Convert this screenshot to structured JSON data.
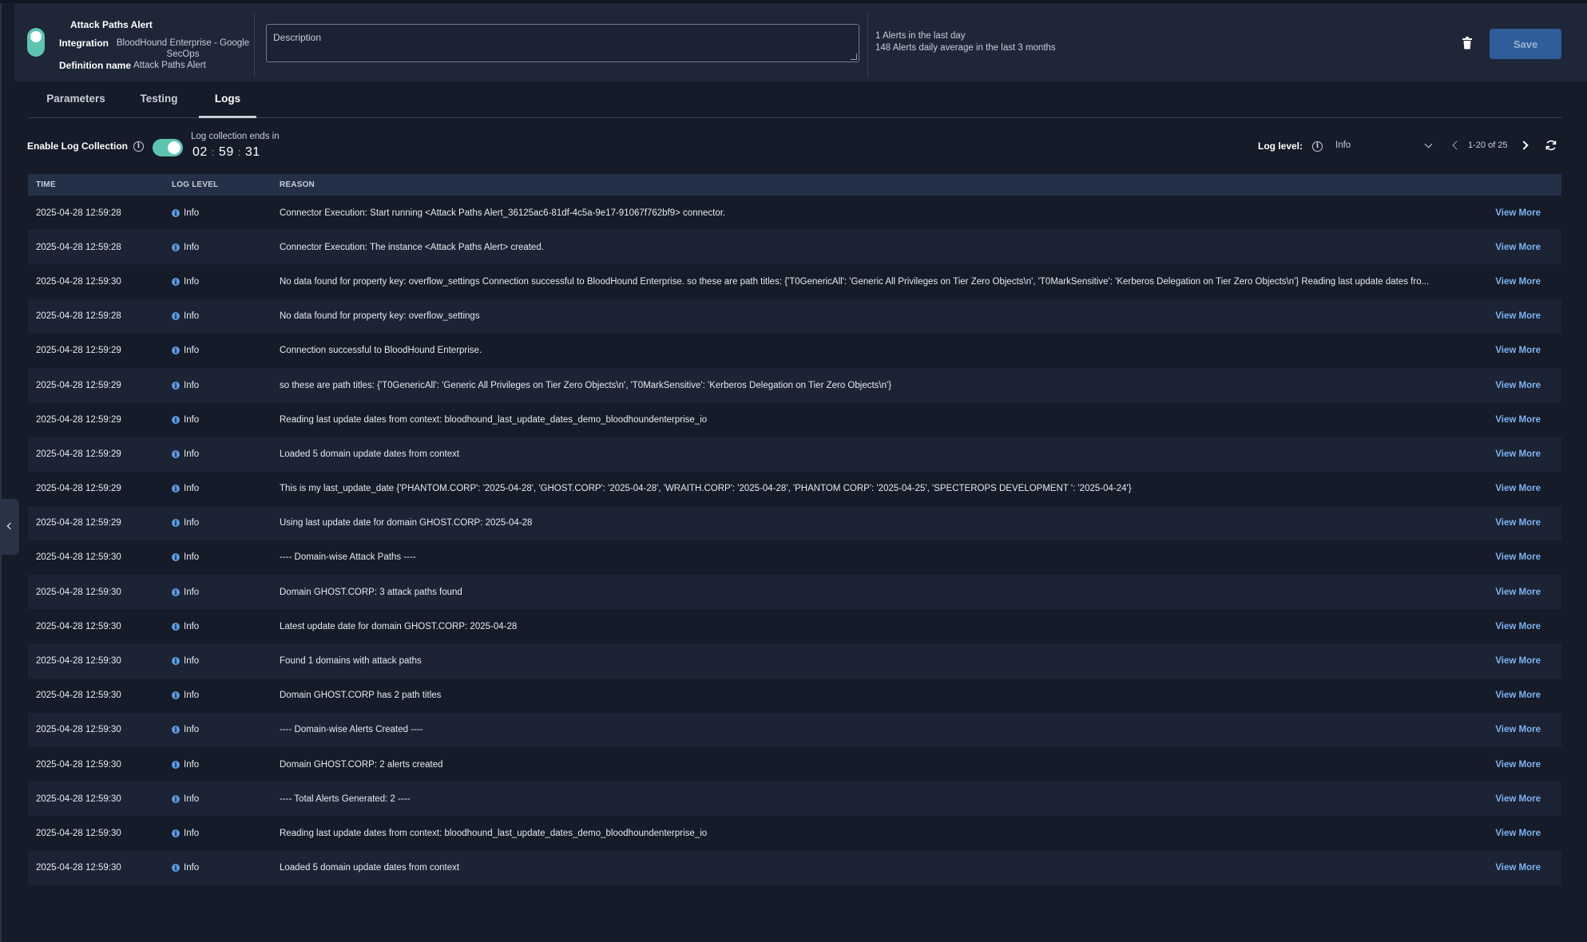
{
  "header": {
    "title": "Attack Paths Alert",
    "integration_label": "Integration",
    "integration_value": "BloodHound Enterprise - Google SecOps",
    "definition_label": "Definition name",
    "definition_value": "Attack Paths Alert",
    "description_placeholder": "Description",
    "alerts_last_day": "1 Alerts in the last day",
    "alerts_daily_avg": "148 Alerts daily average in the last 3 months",
    "save_label": "Save",
    "status_color": "#5ec4b0"
  },
  "tabs": [
    {
      "label": "Parameters"
    },
    {
      "label": "Testing"
    },
    {
      "label": "Logs",
      "active": true
    }
  ],
  "controls": {
    "enable_label": "Enable Log Collection",
    "log_collection_enabled": true,
    "ends_label": "Log collection ends in",
    "timer_h": "02",
    "timer_m": "59",
    "timer_s": "31",
    "log_level_label": "Log level:",
    "log_level_value": "Info",
    "pagination": "1-20 of 25"
  },
  "table": {
    "headers": {
      "time": "TIME",
      "level": "LOG LEVEL",
      "reason": "REASON"
    },
    "view_more_label": "View More",
    "rows": [
      {
        "time": "2025-04-28 12:59:28",
        "level": "Info",
        "reason": "Connector Execution: Start running <Attack Paths Alert_36125ac6-81df-4c5a-9e17-91067f762bf9> connector."
      },
      {
        "time": "2025-04-28 12:59:28",
        "level": "Info",
        "reason": "Connector Execution: The instance <Attack Paths Alert> created."
      },
      {
        "time": "2025-04-28 12:59:30",
        "level": "Info",
        "reason": "No data found for property key: overflow_settings Connection successful to BloodHound Enterprise. so these are path titles: {'T0GenericAll': 'Generic All Privileges on Tier Zero Objects\\n', 'T0MarkSensitive': 'Kerberos Delegation on Tier Zero Objects\\n'} Reading last update dates fro..."
      },
      {
        "time": "2025-04-28 12:59:28",
        "level": "Info",
        "reason": "No data found for property key: overflow_settings"
      },
      {
        "time": "2025-04-28 12:59:29",
        "level": "Info",
        "reason": "Connection successful to BloodHound Enterprise."
      },
      {
        "time": "2025-04-28 12:59:29",
        "level": "Info",
        "reason": "so these are path titles: {'T0GenericAll': 'Generic All Privileges on Tier Zero Objects\\n', 'T0MarkSensitive': 'Kerberos Delegation on Tier Zero Objects\\n'}"
      },
      {
        "time": "2025-04-28 12:59:29",
        "level": "Info",
        "reason": "Reading last update dates from context: bloodhound_last_update_dates_demo_bloodhoundenterprise_io"
      },
      {
        "time": "2025-04-28 12:59:29",
        "level": "Info",
        "reason": "Loaded 5 domain update dates from context"
      },
      {
        "time": "2025-04-28 12:59:29",
        "level": "Info",
        "reason": "This is my last_update_date {'PHANTOM.CORP': '2025-04-28', 'GHOST.CORP': '2025-04-28', 'WRAITH.CORP': '2025-04-28', 'PHANTOM CORP': '2025-04-25', 'SPECTEROPS DEVELOPMENT ': '2025-04-24'}"
      },
      {
        "time": "2025-04-28 12:59:29",
        "level": "Info",
        "reason": "Using last update date for domain GHOST.CORP: 2025-04-28"
      },
      {
        "time": "2025-04-28 12:59:30",
        "level": "Info",
        "reason": "---- Domain-wise Attack Paths ----"
      },
      {
        "time": "2025-04-28 12:59:30",
        "level": "Info",
        "reason": "Domain GHOST.CORP: 3 attack paths found"
      },
      {
        "time": "2025-04-28 12:59:30",
        "level": "Info",
        "reason": "Latest update date for domain GHOST.CORP: 2025-04-28"
      },
      {
        "time": "2025-04-28 12:59:30",
        "level": "Info",
        "reason": "Found 1 domains with attack paths"
      },
      {
        "time": "2025-04-28 12:59:30",
        "level": "Info",
        "reason": "Domain GHOST.CORP has 2 path titles"
      },
      {
        "time": "2025-04-28 12:59:30",
        "level": "Info",
        "reason": "---- Domain-wise Alerts Created ----"
      },
      {
        "time": "2025-04-28 12:59:30",
        "level": "Info",
        "reason": "Domain GHOST.CORP: 2 alerts created"
      },
      {
        "time": "2025-04-28 12:59:30",
        "level": "Info",
        "reason": "---- Total Alerts Generated: 2 ----"
      },
      {
        "time": "2025-04-28 12:59:30",
        "level": "Info",
        "reason": "Reading last update dates from context: bloodhound_last_update_dates_demo_bloodhoundenterprise_io"
      },
      {
        "time": "2025-04-28 12:59:30",
        "level": "Info",
        "reason": "Loaded 5 domain update dates from context"
      }
    ]
  },
  "icons": {
    "trash": "trash-icon",
    "info": "info-icon",
    "refresh": "refresh-icon",
    "collapse": "chevron-left-icon"
  }
}
